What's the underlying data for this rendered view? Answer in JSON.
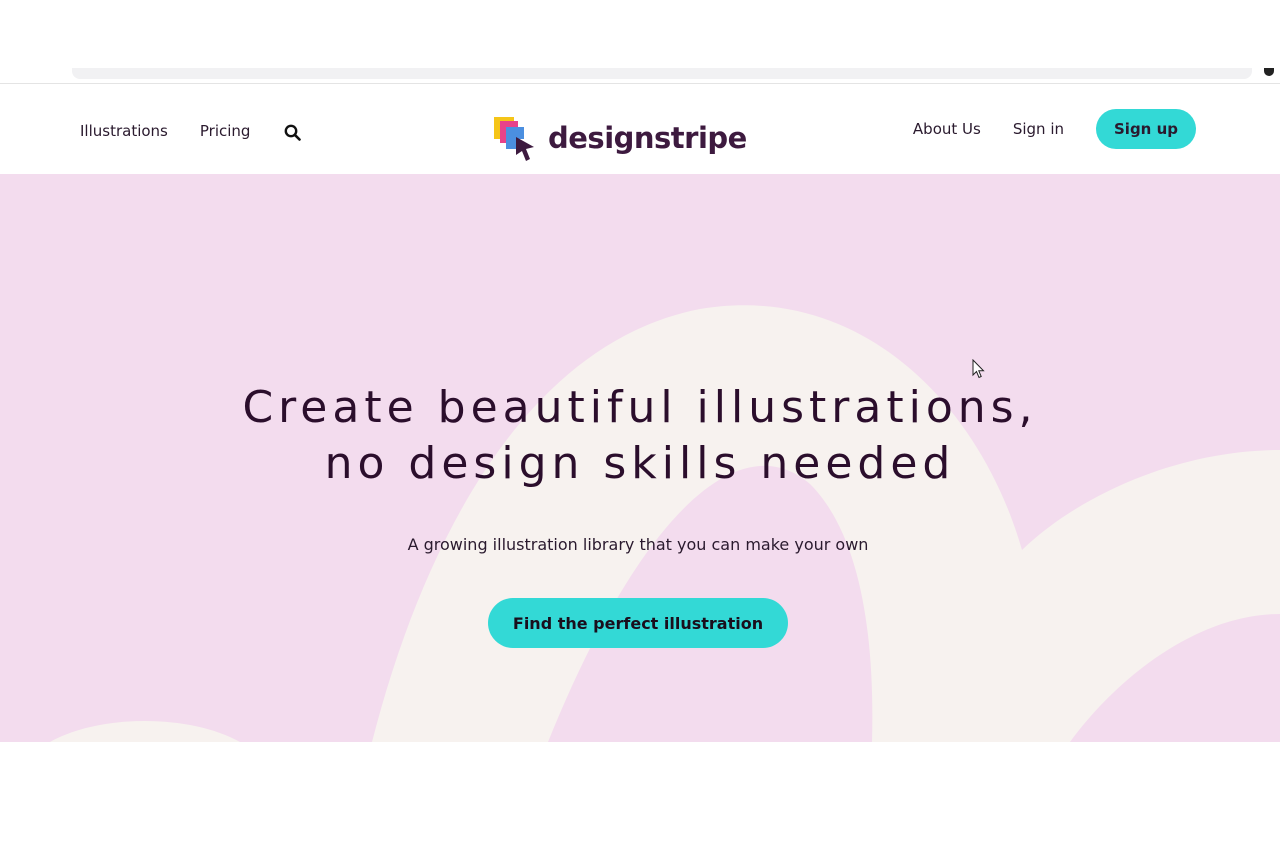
{
  "header": {
    "nav_left": [
      "Illustrations",
      "Pricing"
    ],
    "brand": "designstripe",
    "nav_right": [
      "About Us",
      "Sign in"
    ],
    "signup_label": "Sign up"
  },
  "hero": {
    "title_line1": "Create beautiful illustrations,",
    "title_line2": "no design skills needed",
    "subtitle": "A growing illustration library that you can make your own",
    "cta_label": "Find the perfect illustration"
  },
  "colors": {
    "accent": "#33d9d6",
    "hero_bg": "#f3dcee",
    "hero_shape": "#f7f2ef",
    "brand_text": "#3d1a3f",
    "title_text": "#2b0e2c"
  },
  "icons": {
    "search": "search-icon",
    "logo": "designstripe-logo-icon",
    "cursor": "mouse-cursor-icon"
  }
}
